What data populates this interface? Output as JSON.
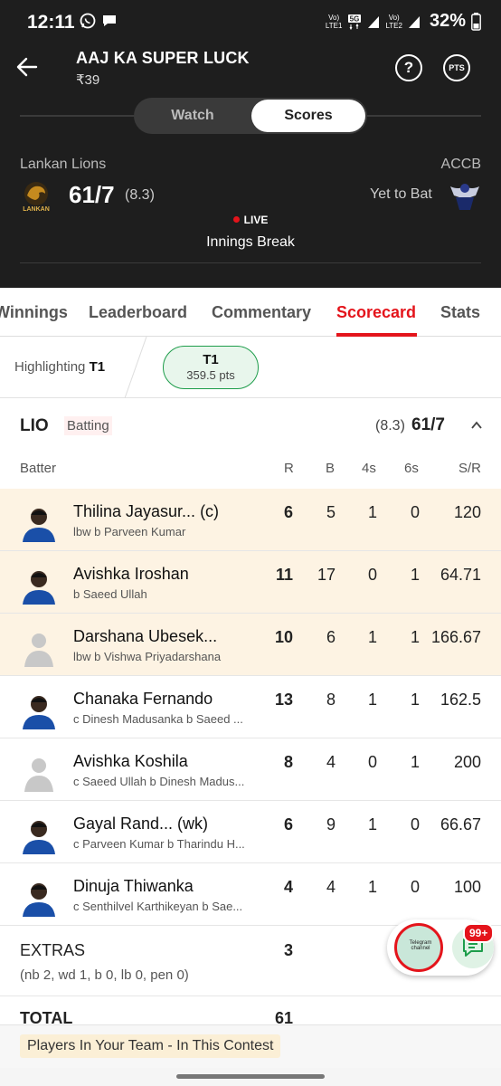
{
  "status_bar": {
    "time": "12:11",
    "battery": "32%",
    "sim1": "LTE1",
    "sim2": "LTE2"
  },
  "header": {
    "title": "AAJ KA SUPER LUCK",
    "price": "₹39",
    "help_icon": "?",
    "pts_label": "PTS"
  },
  "toggle": {
    "watch": "Watch",
    "scores": "Scores",
    "active": "Scores"
  },
  "match": {
    "team_left": {
      "name": "Lankan Lions",
      "logo_text": "LANKAN",
      "score": "61/7",
      "overs": "(8.3)"
    },
    "team_right": {
      "name": "ACCB",
      "status": "Yet to Bat"
    },
    "live_label": "LIVE",
    "state": "Innings Break"
  },
  "tabs": [
    "Winnings",
    "Leaderboard",
    "Commentary",
    "Scorecard",
    "Stats"
  ],
  "active_tab": "Scorecard",
  "highlight": {
    "prefix": "Highlighting",
    "team": "T1",
    "pill_title": "T1",
    "pill_points": "359.5 pts"
  },
  "innings": {
    "team": "LIO",
    "label": "Batting",
    "overs": "(8.3)",
    "score": "61/7"
  },
  "columns": {
    "batter": "Batter",
    "r": "R",
    "b": "B",
    "fours": "4s",
    "sixes": "6s",
    "sr": "S/R"
  },
  "batters": [
    {
      "name": "Thilina Jayasur...  (c)",
      "dismissal": "lbw b Parveen Kumar",
      "r": "6",
      "b": "5",
      "fours": "1",
      "sixes": "0",
      "sr": "120",
      "highlighted": true,
      "photo": true
    },
    {
      "name": "Avishka Iroshan",
      "dismissal": "b Saeed Ullah",
      "r": "11",
      "b": "17",
      "fours": "0",
      "sixes": "1",
      "sr": "64.71",
      "highlighted": true,
      "photo": true
    },
    {
      "name": "Darshana Ubesek...",
      "dismissal": "lbw b Vishwa Priyadarshana",
      "r": "10",
      "b": "6",
      "fours": "1",
      "sixes": "1",
      "sr": "166.67",
      "highlighted": true,
      "photo": false
    },
    {
      "name": "Chanaka Fernando",
      "dismissal": "c Dinesh Madusanka b Saeed ...",
      "r": "13",
      "b": "8",
      "fours": "1",
      "sixes": "1",
      "sr": "162.5",
      "highlighted": false,
      "photo": true
    },
    {
      "name": "Avishka Koshila",
      "dismissal": "c Saeed Ullah b Dinesh Madus...",
      "r": "8",
      "b": "4",
      "fours": "0",
      "sixes": "1",
      "sr": "200",
      "highlighted": false,
      "photo": false
    },
    {
      "name": "Gayal Rand...  (wk)",
      "dismissal": "c Parveen Kumar b Tharindu H...",
      "r": "6",
      "b": "9",
      "fours": "1",
      "sixes": "0",
      "sr": "66.67",
      "highlighted": false,
      "photo": true
    },
    {
      "name": "Dinuja Thiwanka",
      "dismissal": "c Senthilvel Karthikeyan b Sae...",
      "r": "4",
      "b": "4",
      "fours": "1",
      "sixes": "0",
      "sr": "100",
      "highlighted": false,
      "photo": true
    }
  ],
  "extras": {
    "label": "EXTRAS",
    "value": "3",
    "detail": "(nb 2, wd 1, b 0, lb 0, pen 0)"
  },
  "total": {
    "label": "TOTAL",
    "value": "61"
  },
  "footer_note": "Players In Your Team - In This Contest",
  "floating": {
    "thumb_text": "Telegram channel",
    "badge": "99+"
  },
  "colors": {
    "accent": "#e4141b",
    "header_bg": "#1e1e1e",
    "highlight_row": "#fdf3e3",
    "pill_green": "#1e9d4b"
  }
}
